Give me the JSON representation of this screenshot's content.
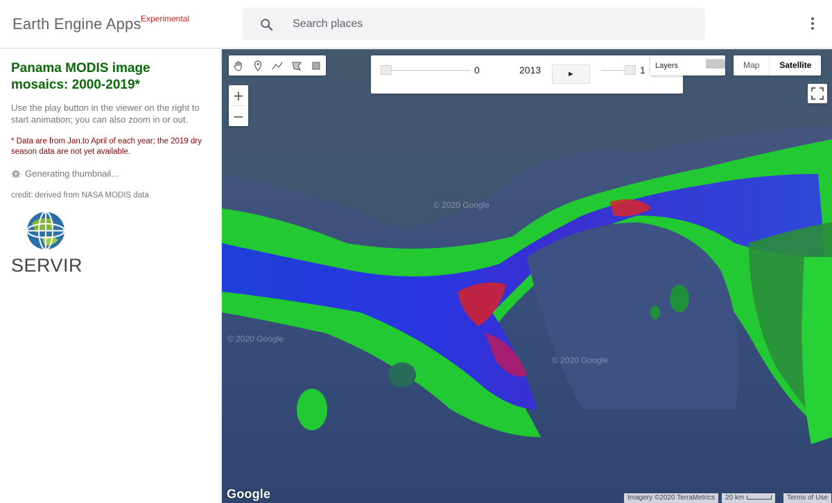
{
  "header": {
    "brand": "Earth Engine Apps",
    "brand_tag": "Experimental",
    "search_placeholder": "Search places",
    "more_icon": "more-vert-icon"
  },
  "panel": {
    "title": "Panama MODIS image mosaics: 2000-2019*",
    "description": "Use the play button in the viewer on the right to start animation; you can also zoom in or out.",
    "note": "* Data are from Jan.to April of each year; the 2019 dry season data are not yet available.",
    "status": "Generating thumbnail...",
    "credit": "credit: derived from NASA MODIS data",
    "logo_text": "SERVIR",
    "note_color": "#8b0000",
    "title_color": "#0a6a0a"
  },
  "map": {
    "tools": [
      "pan-hand-icon",
      "marker-icon",
      "polyline-icon",
      "polygon-icon",
      "rectangle-icon"
    ],
    "zoom_in": "+",
    "zoom_out": "−",
    "animation": {
      "slider1_value": "0",
      "year": "2013",
      "play_label": "►",
      "slider2_value": "1"
    },
    "layers_label": "Layers",
    "map_type": {
      "map_label": "Map",
      "satellite_label": "Satellite",
      "selected": "Satellite"
    },
    "google_logo": "Google",
    "imagery_credit": "Imagery ©2020 TerraMetrics",
    "scale": "20 km",
    "terms": "Terms of Use",
    "watermark": "© 2020 Google"
  }
}
